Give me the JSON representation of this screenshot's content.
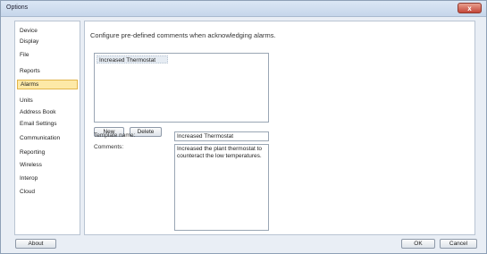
{
  "window": {
    "title": "Options",
    "close_label": "x"
  },
  "sidebar": {
    "items": [
      {
        "label": "Device",
        "selected": false
      },
      {
        "label": "Display",
        "selected": false
      },
      {
        "label": "File",
        "selected": false
      },
      {
        "label": "Reports",
        "selected": false
      },
      {
        "label": "Alarms",
        "selected": true
      },
      {
        "label": "Units",
        "selected": false
      },
      {
        "label": "Address Book",
        "selected": false
      },
      {
        "label": "Email Settings",
        "selected": false
      },
      {
        "label": "Communication",
        "selected": false
      },
      {
        "label": "Reporting",
        "selected": false
      },
      {
        "label": "Wireless",
        "selected": false
      },
      {
        "label": "Interop",
        "selected": false
      },
      {
        "label": "Cloud",
        "selected": false
      }
    ]
  },
  "main": {
    "heading": "Configure pre-defined comments when acknowledging alarms.",
    "templates": [
      "Increased Thermostat"
    ],
    "new_label": "New",
    "delete_label": "Delete",
    "template_name_label": "Template name:",
    "template_name_value": "Increased Thermostat",
    "comments_label": "Comments:",
    "comments_value": "Increased the plant thermostat to counteract the low temperatures."
  },
  "footer": {
    "about_label": "About",
    "ok_label": "OK",
    "cancel_label": "Cancel"
  },
  "colors": {
    "selected_bg": "#fde9a7",
    "selected_border": "#e2b54a",
    "close_button": "#c4473a"
  }
}
